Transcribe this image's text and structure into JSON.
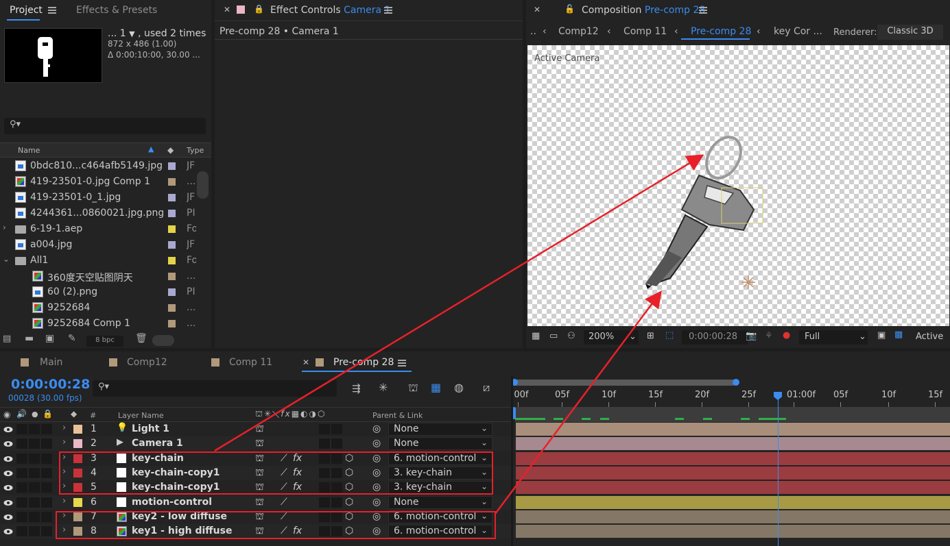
{
  "project_panel": {
    "tab_project": "Project",
    "tab_effects": "Effects & Presets",
    "preview": {
      "name": "... 1",
      "used": ", used 2 times",
      "dims": "872 x 486 (1.00)",
      "duration": "Δ 0:00:10:00, 30.00 ..."
    },
    "search_placeholder": "",
    "col_name": "Name",
    "col_type": "Type",
    "items": [
      {
        "name": "0bdc810...c464afb5149.jpg",
        "type": "JF",
        "label": "#a9a9cf",
        "icon": "image-file-icon",
        "indent": 0
      },
      {
        "name": "419-23501-0.jpg Comp 1",
        "type": "...",
        "label": "#b09a7a",
        "icon": "composition-icon",
        "indent": 0
      },
      {
        "name": "419-23501-0_1.jpg",
        "type": "JF",
        "label": "#a9a9cf",
        "icon": "image-file-icon",
        "indent": 0
      },
      {
        "name": "4244361...0860021.jpg.png",
        "type": "PI",
        "label": "#a9a9cf",
        "icon": "image-file-icon",
        "indent": 0
      },
      {
        "name": "6-19-1.aep",
        "type": "Fo",
        "label": "#e3d34a",
        "icon": "folder-icon",
        "indent": 0
      },
      {
        "name": "a004.jpg",
        "type": "JF",
        "label": "#a9a9cf",
        "icon": "image-file-icon",
        "indent": 0
      },
      {
        "name": "All1",
        "type": "Fo",
        "label": "#e3d34a",
        "icon": "folder-icon",
        "indent": 0
      },
      {
        "name": "360度天空贴图阴天",
        "type": "...",
        "label": "#b09a7a",
        "icon": "composition-icon",
        "indent": 1
      },
      {
        "name": "60 (2).png",
        "type": "PI",
        "label": "#a9a9cf",
        "icon": "image-file-icon",
        "indent": 1
      },
      {
        "name": "9252684",
        "type": "...",
        "label": "#b09a7a",
        "icon": "composition-icon",
        "indent": 1
      },
      {
        "name": "9252684 Comp 1",
        "type": "...",
        "label": "#b09a7a",
        "icon": "composition-icon",
        "indent": 1
      }
    ],
    "bpc": "8 bpc"
  },
  "effect_controls": {
    "tab_label": "Effect Controls",
    "tab_target": "Camera 1",
    "breadcrumb": "Pre-comp 28 • Camera 1"
  },
  "composition_panel": {
    "tab_label": "Composition",
    "tab_target": "Pre-comp 28",
    "flow": [
      "Comp12",
      "Comp 11",
      "Pre-comp 28",
      "key Cor ..."
    ],
    "renderer_label": "Renderer:",
    "renderer_value": "Classic 3D",
    "viewer_label": "Active Camera",
    "zoom": "200%",
    "timecode": "0:00:00:28",
    "resolution": "Full",
    "view": "Active"
  },
  "timeline": {
    "tabs": [
      "Main",
      "Comp12",
      "Comp 11",
      "Pre-comp 28"
    ],
    "tab_colors": [
      "#b09a7a",
      "#b09a7a",
      "#b09a7a",
      "#b09a7a"
    ],
    "timecode": "0:00:00:28",
    "frame_info": "00028 (30.00 fps)",
    "col_hash": "#",
    "col_layer_name": "Layer Name",
    "col_parent": "Parent & Link",
    "ruler": [
      ":00f",
      "05f",
      "10f",
      "15f",
      "20f",
      "25f",
      "01:00f",
      "05f",
      "10f",
      "15f"
    ],
    "layers": [
      {
        "num": "1",
        "name": "Light 1",
        "label": "#e8c19a",
        "parent": "None",
        "bar": "#a88e7b",
        "kind": "light"
      },
      {
        "num": "2",
        "name": "Camera 1",
        "label": "#e9b7c6",
        "parent": "None",
        "bar": "#a68a90",
        "kind": "camera"
      },
      {
        "num": "3",
        "name": "key-chain",
        "label": "#c8323b",
        "parent": "6. motion-control",
        "bar": "#9b3c40",
        "kind": "solid"
      },
      {
        "num": "4",
        "name": "key-chain-copy1",
        "label": "#c8323b",
        "parent": "3. key-chain",
        "bar": "#9b3c40",
        "kind": "solid"
      },
      {
        "num": "5",
        "name": "key-chain-copy1",
        "label": "#c8323b",
        "parent": "3. key-chain",
        "bar": "#9b3c40",
        "kind": "solid"
      },
      {
        "num": "6",
        "name": "motion-control",
        "label": "#e7d84d",
        "parent": "None",
        "bar": "#a89a45",
        "kind": "solid"
      },
      {
        "num": "7",
        "name": "key2 - low diffuse",
        "label": "#b09a7a",
        "parent": "6. motion-control",
        "bar": "#857766",
        "kind": "comp"
      },
      {
        "num": "8",
        "name": "key1 - high diffuse",
        "label": "#b09a7a",
        "parent": "6. motion-control",
        "bar": "#857766",
        "kind": "comp"
      }
    ]
  },
  "colors": {
    "accent": "#3b8cf0",
    "annotation": "#e8202a"
  }
}
